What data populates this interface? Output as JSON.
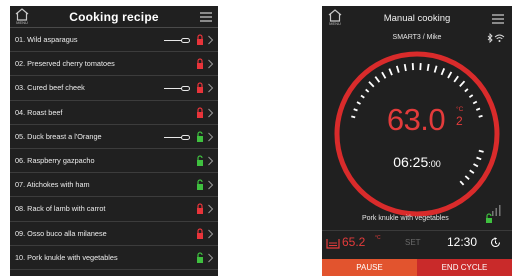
{
  "left": {
    "title": "Cooking recipe",
    "menu_label": "MENU",
    "recipes": [
      {
        "label": "01. Wild asparagus",
        "slider": true,
        "locked": true
      },
      {
        "label": "02. Preserved cherry tomatoes",
        "slider": false,
        "locked": true
      },
      {
        "label": "03. Cured beef cheek",
        "slider": true,
        "locked": true
      },
      {
        "label": "04. Roast beef",
        "slider": false,
        "locked": true
      },
      {
        "label": "05. Duck breast a l'Orange",
        "slider": true,
        "locked": false
      },
      {
        "label": "06. Raspberry gazpacho",
        "slider": false,
        "locked": false
      },
      {
        "label": "07. Atichokes with ham",
        "slider": false,
        "locked": false
      },
      {
        "label": "08. Rack of lamb with carrot",
        "slider": false,
        "locked": true
      },
      {
        "label": "09. Osso buco alla milanese",
        "slider": false,
        "locked": true
      },
      {
        "label": "10. Pork knukle with vegetables",
        "slider": false,
        "locked": false
      }
    ]
  },
  "right": {
    "title": "Manual cooking",
    "menu_label": "MENU",
    "device_user": "SMART3 / Mike",
    "temp_main": "63.0",
    "temp_unit": "°C",
    "temp_decimal_sub": "2",
    "timer_main": "06:25",
    "timer_sec": ":00",
    "recipe_name": "Pork knukle with vegetables",
    "tank_temp": "65.2",
    "tank_unit": "°C",
    "set_label": "SET",
    "clock": "12:30",
    "pause_label": "PAUSE",
    "end_label": "END CYCLE"
  },
  "colors": {
    "panel_bg": "#202020",
    "accent_red": "#e33b3b",
    "lock_locked": "#e8343a",
    "lock_unlocked": "#3fc03f",
    "pause_orange": "#e2542e",
    "end_red": "#c92a2a"
  },
  "icons": {
    "home": "home-icon",
    "menu": "hamburger-menu-icon",
    "lock": "padlock-icon",
    "chevron": "chevron-right-icon",
    "bluetooth": "bluetooth-icon",
    "wifi": "wifi-icon",
    "tank": "water-tank-icon",
    "timer": "timer-icon",
    "bars": "signal-bars-icon"
  }
}
